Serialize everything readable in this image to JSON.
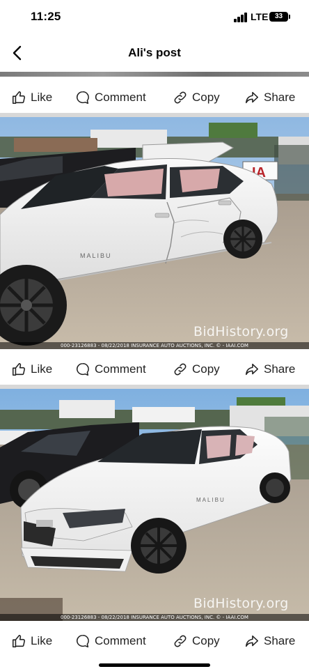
{
  "status_bar": {
    "time": "11:25",
    "network": "LTE",
    "battery": "33"
  },
  "nav": {
    "title": "Ali's post"
  },
  "actions": {
    "like": "Like",
    "comment": "Comment",
    "copy": "Copy",
    "share": "Share"
  },
  "photos": [
    {
      "sign": "IA",
      "badge": "MALIBU",
      "watermark_prefix": "BidHistory",
      "watermark_suffix": ".org",
      "caption": "000-23126883 - 08/22/2018 INSURANCE AUTO AUCTIONS, INC. © - IAAI.COM"
    },
    {
      "badge": "MALIBU",
      "watermark_prefix": "BidHistory",
      "watermark_suffix": ".org",
      "caption": "000-23126883 - 08/22/2018 INSURANCE AUTO AUCTIONS, INC. © - IAAI.COM"
    }
  ],
  "colors": {
    "text": "#050505",
    "divider": "#d8d8d8",
    "car": "#f4f4f2",
    "sky": "#a9c9e6",
    "ground": "#b9ada0"
  }
}
